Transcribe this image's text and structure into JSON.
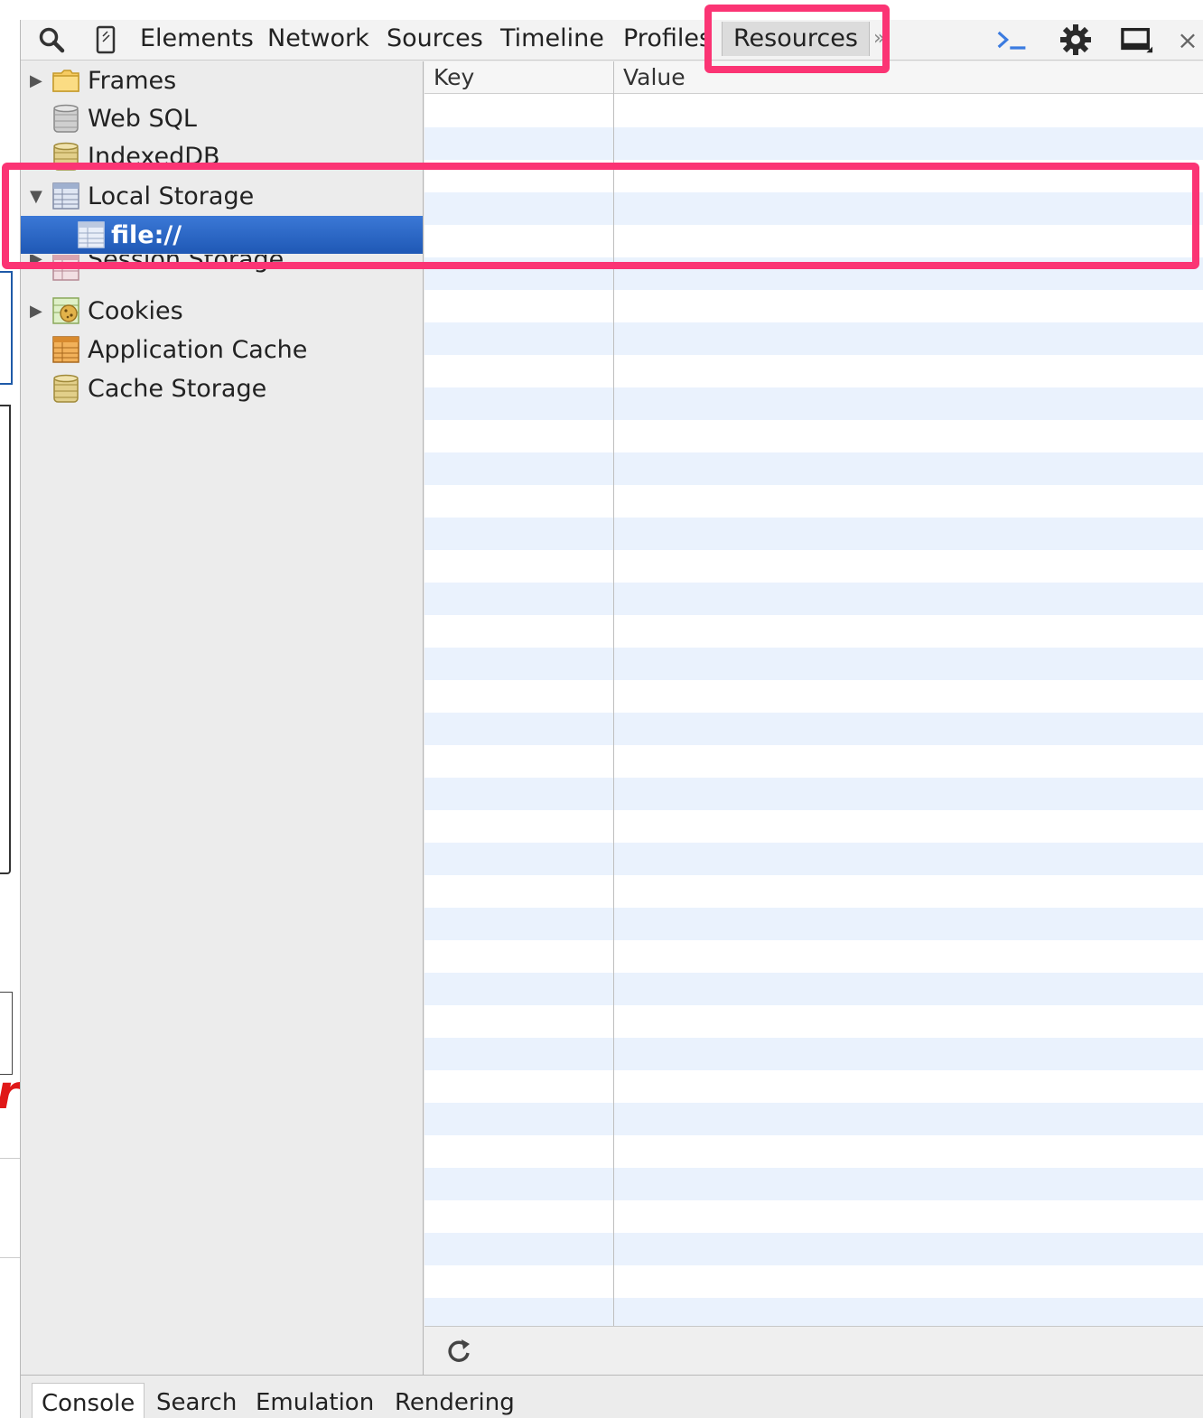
{
  "toolbar": {
    "tabs": [
      "Elements",
      "Network",
      "Sources",
      "Timeline",
      "Profiles",
      "Resources"
    ],
    "active_tab": "Resources",
    "overflow_marker": "»",
    "close_glyph": "×",
    "icons": [
      "search-icon",
      "device-mode-icon",
      "console-drawer-icon",
      "settings-gear-icon",
      "dock-side-icon",
      "close-icon"
    ]
  },
  "sidebar": {
    "items": [
      {
        "label": "Frames",
        "icon": "folder-icon",
        "expandable": true,
        "expanded": false
      },
      {
        "label": "Web SQL",
        "icon": "database-icon",
        "expandable": false
      },
      {
        "label": "IndexedDB",
        "icon": "database-icon",
        "expandable": false
      },
      {
        "label": "Local Storage",
        "icon": "storage-table-icon",
        "expandable": true,
        "expanded": true
      },
      {
        "label": "file://",
        "icon": "storage-table-icon",
        "selected": true
      },
      {
        "label": "Session Storage",
        "icon": "storage-table-icon",
        "expandable": true,
        "expanded": false
      },
      {
        "label": "Cookies",
        "icon": "cookie-icon",
        "expandable": true,
        "expanded": false
      },
      {
        "label": "Application Cache",
        "icon": "app-cache-icon",
        "expandable": false
      },
      {
        "label": "Cache Storage",
        "icon": "database-icon",
        "expandable": false
      }
    ]
  },
  "grid": {
    "columns": [
      "Key",
      "Value"
    ],
    "rows": []
  },
  "drawer": {
    "tabs": [
      "Console",
      "Search",
      "Emulation",
      "Rendering"
    ],
    "active_tab": "Console"
  },
  "background_page": {
    "fragment_text": "r”"
  },
  "colors": {
    "highlight": "#fb3474",
    "selection": "#2a63c2",
    "stripe": "#eaf2fd",
    "console_icon": "#3b7be0",
    "fragment_text": "#e01818"
  }
}
